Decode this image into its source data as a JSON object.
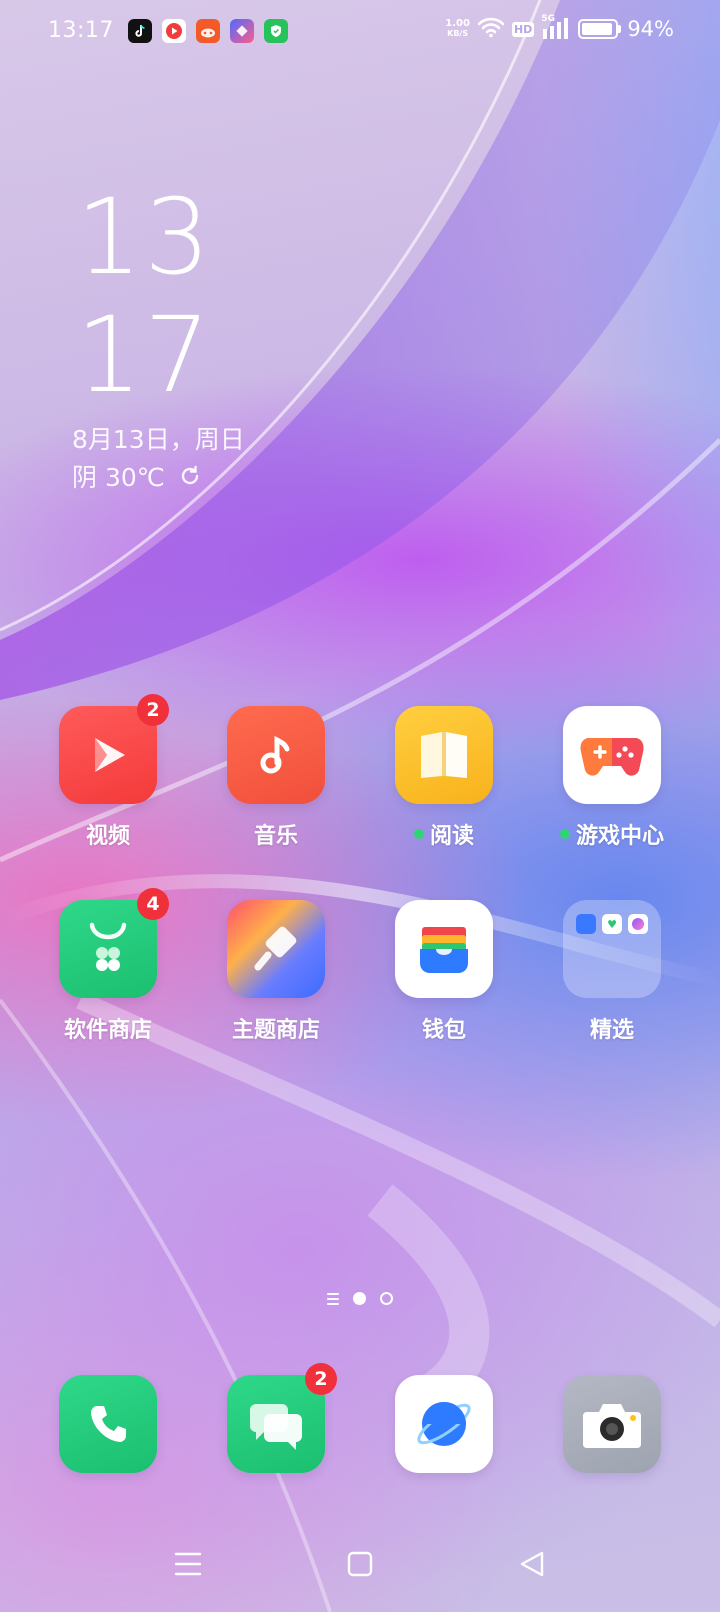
{
  "status_bar": {
    "time": "13:17",
    "notification_apps": [
      "tiktok-icon",
      "video-app-icon",
      "game-app-icon",
      "shortcut-app-icon",
      "security-app-icon"
    ],
    "net_speed_value": "1.00",
    "net_speed_unit": "KB/S",
    "hd_label": "HD",
    "network_label": "5G",
    "battery_percent": "94%",
    "battery_level": 0.94
  },
  "clock_widget": {
    "hour": "13",
    "minute": "17",
    "date": "8月13日，周日",
    "weather": "阴  30℃"
  },
  "apps": [
    {
      "label": "视频",
      "icon": "video-play-icon",
      "badge": "2",
      "dot": false
    },
    {
      "label": "音乐",
      "icon": "music-note-icon",
      "badge": "",
      "dot": false
    },
    {
      "label": "阅读",
      "icon": "book-icon",
      "badge": "",
      "dot": true
    },
    {
      "label": "游戏中心",
      "icon": "gamepad-icon",
      "badge": "",
      "dot": true
    },
    {
      "label": "软件商店",
      "icon": "app-store-icon",
      "badge": "4",
      "dot": false
    },
    {
      "label": "主题商店",
      "icon": "paint-brush-icon",
      "badge": "",
      "dot": false
    },
    {
      "label": "钱包",
      "icon": "wallet-icon",
      "badge": "",
      "dot": false
    },
    {
      "label": "精选",
      "icon": "folder-icon",
      "badge": "",
      "dot": false
    }
  ],
  "dock": [
    {
      "name": "phone",
      "icon": "phone-icon",
      "badge": ""
    },
    {
      "name": "messages",
      "icon": "chat-bubbles-icon",
      "badge": "2"
    },
    {
      "name": "browser",
      "icon": "planet-icon",
      "badge": ""
    },
    {
      "name": "camera",
      "icon": "camera-icon",
      "badge": ""
    }
  ],
  "colors": {
    "badge": "#f0303a",
    "green_dot": "#2ed573"
  }
}
